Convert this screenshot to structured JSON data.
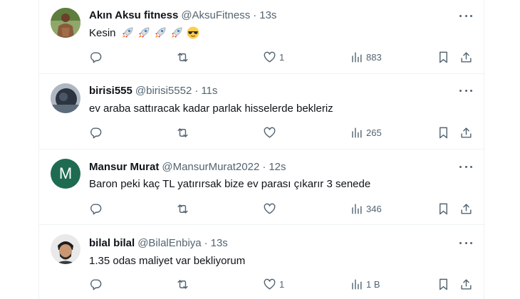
{
  "tweets": [
    {
      "name": "Akın Aksu fitness",
      "handle": "@AksuFitness",
      "dot": "·",
      "time": "13s",
      "text": "Kesin",
      "emojis": [
        "rocket-emoji",
        "rocket-emoji",
        "rocket-emoji",
        "rocket-emoji",
        "sunglasses-emoji"
      ],
      "likes": "1",
      "views": "883",
      "avatar_color": "#6b8f4e"
    },
    {
      "name": "birisi555",
      "handle": "@birisi5552",
      "dot": "·",
      "time": "11s",
      "text": "ev araba sattıracak kadar parlak hisselerde bekleriz",
      "likes": "",
      "views": "265",
      "avatar_color": "#3c4a5a"
    },
    {
      "name": "Mansur Murat",
      "handle": "@MansurMurat2022",
      "dot": "·",
      "time": "12s",
      "text": "Baron peki kaç TL yatırırsak bize ev parası çıkarır 3 senede",
      "likes": "",
      "views": "346",
      "avatar_letter": "M",
      "avatar_color": "#1f6b50"
    },
    {
      "name": "bilal bilal",
      "handle": "@BilalEnbiya",
      "dot": "·",
      "time": "13s",
      "text": "1.35 odas maliyet var bekliyorum",
      "likes": "1",
      "views": "1 B",
      "avatar_color": "#2a2a2a"
    }
  ],
  "icons": {
    "reply": "reply-icon",
    "retweet": "retweet-icon",
    "like": "heart-icon",
    "views": "views-icon",
    "bookmark": "bookmark-icon",
    "share": "share-icon",
    "more": "more-icon"
  },
  "colors": {
    "text": "#0f1419",
    "secondary": "#536471",
    "border": "#eff3f4"
  }
}
